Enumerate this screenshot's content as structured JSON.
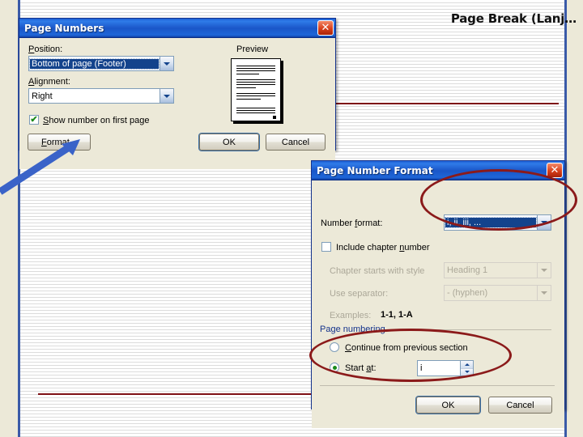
{
  "slide": {
    "title": "Page Break (Lanj…"
  },
  "dialog1": {
    "title": "Page Numbers",
    "close_icon": "close-icon",
    "position_label": "Position:",
    "position_value": "Bottom of page (Footer)",
    "alignment_label": "Alignment:",
    "alignment_value": "Right",
    "show_first_page_label": "Show number on first page",
    "show_first_page_checked": "✔",
    "preview_label": "Preview",
    "format_button": "Format...",
    "ok_button": "OK",
    "cancel_button": "Cancel"
  },
  "dialog2": {
    "title": "Page Number Format",
    "close_icon": "close-icon",
    "number_format_label": "Number format:",
    "number_format_value": "i, ii, iii, ...",
    "include_chapter_label": "Include chapter number",
    "chapter_style_label": "Chapter starts with style",
    "chapter_style_value": "Heading 1",
    "separator_label": "Use separator:",
    "separator_value": "-     (hyphen)",
    "examples_label": "Examples:",
    "examples_value": "1-1, 1-A",
    "page_numbering_group": "Page numbering",
    "continue_label": "Continue from previous section",
    "start_at_label": "Start at:",
    "start_at_value": "i",
    "ok_button": "OK",
    "cancel_button": "Cancel"
  },
  "annotations": {
    "ellipse_number_format": "highlight-number-format",
    "ellipse_start_at": "highlight-start-at",
    "arrow_to_format": "arrow-pointing-to-format-button"
  },
  "colors": {
    "annotation_red": "#8b1a1a",
    "arrow_blue": "#3a63c8",
    "rule_red": "#7e1015",
    "titlebar_blue": "#1a56c8",
    "dialog_face": "#ece9d8"
  }
}
